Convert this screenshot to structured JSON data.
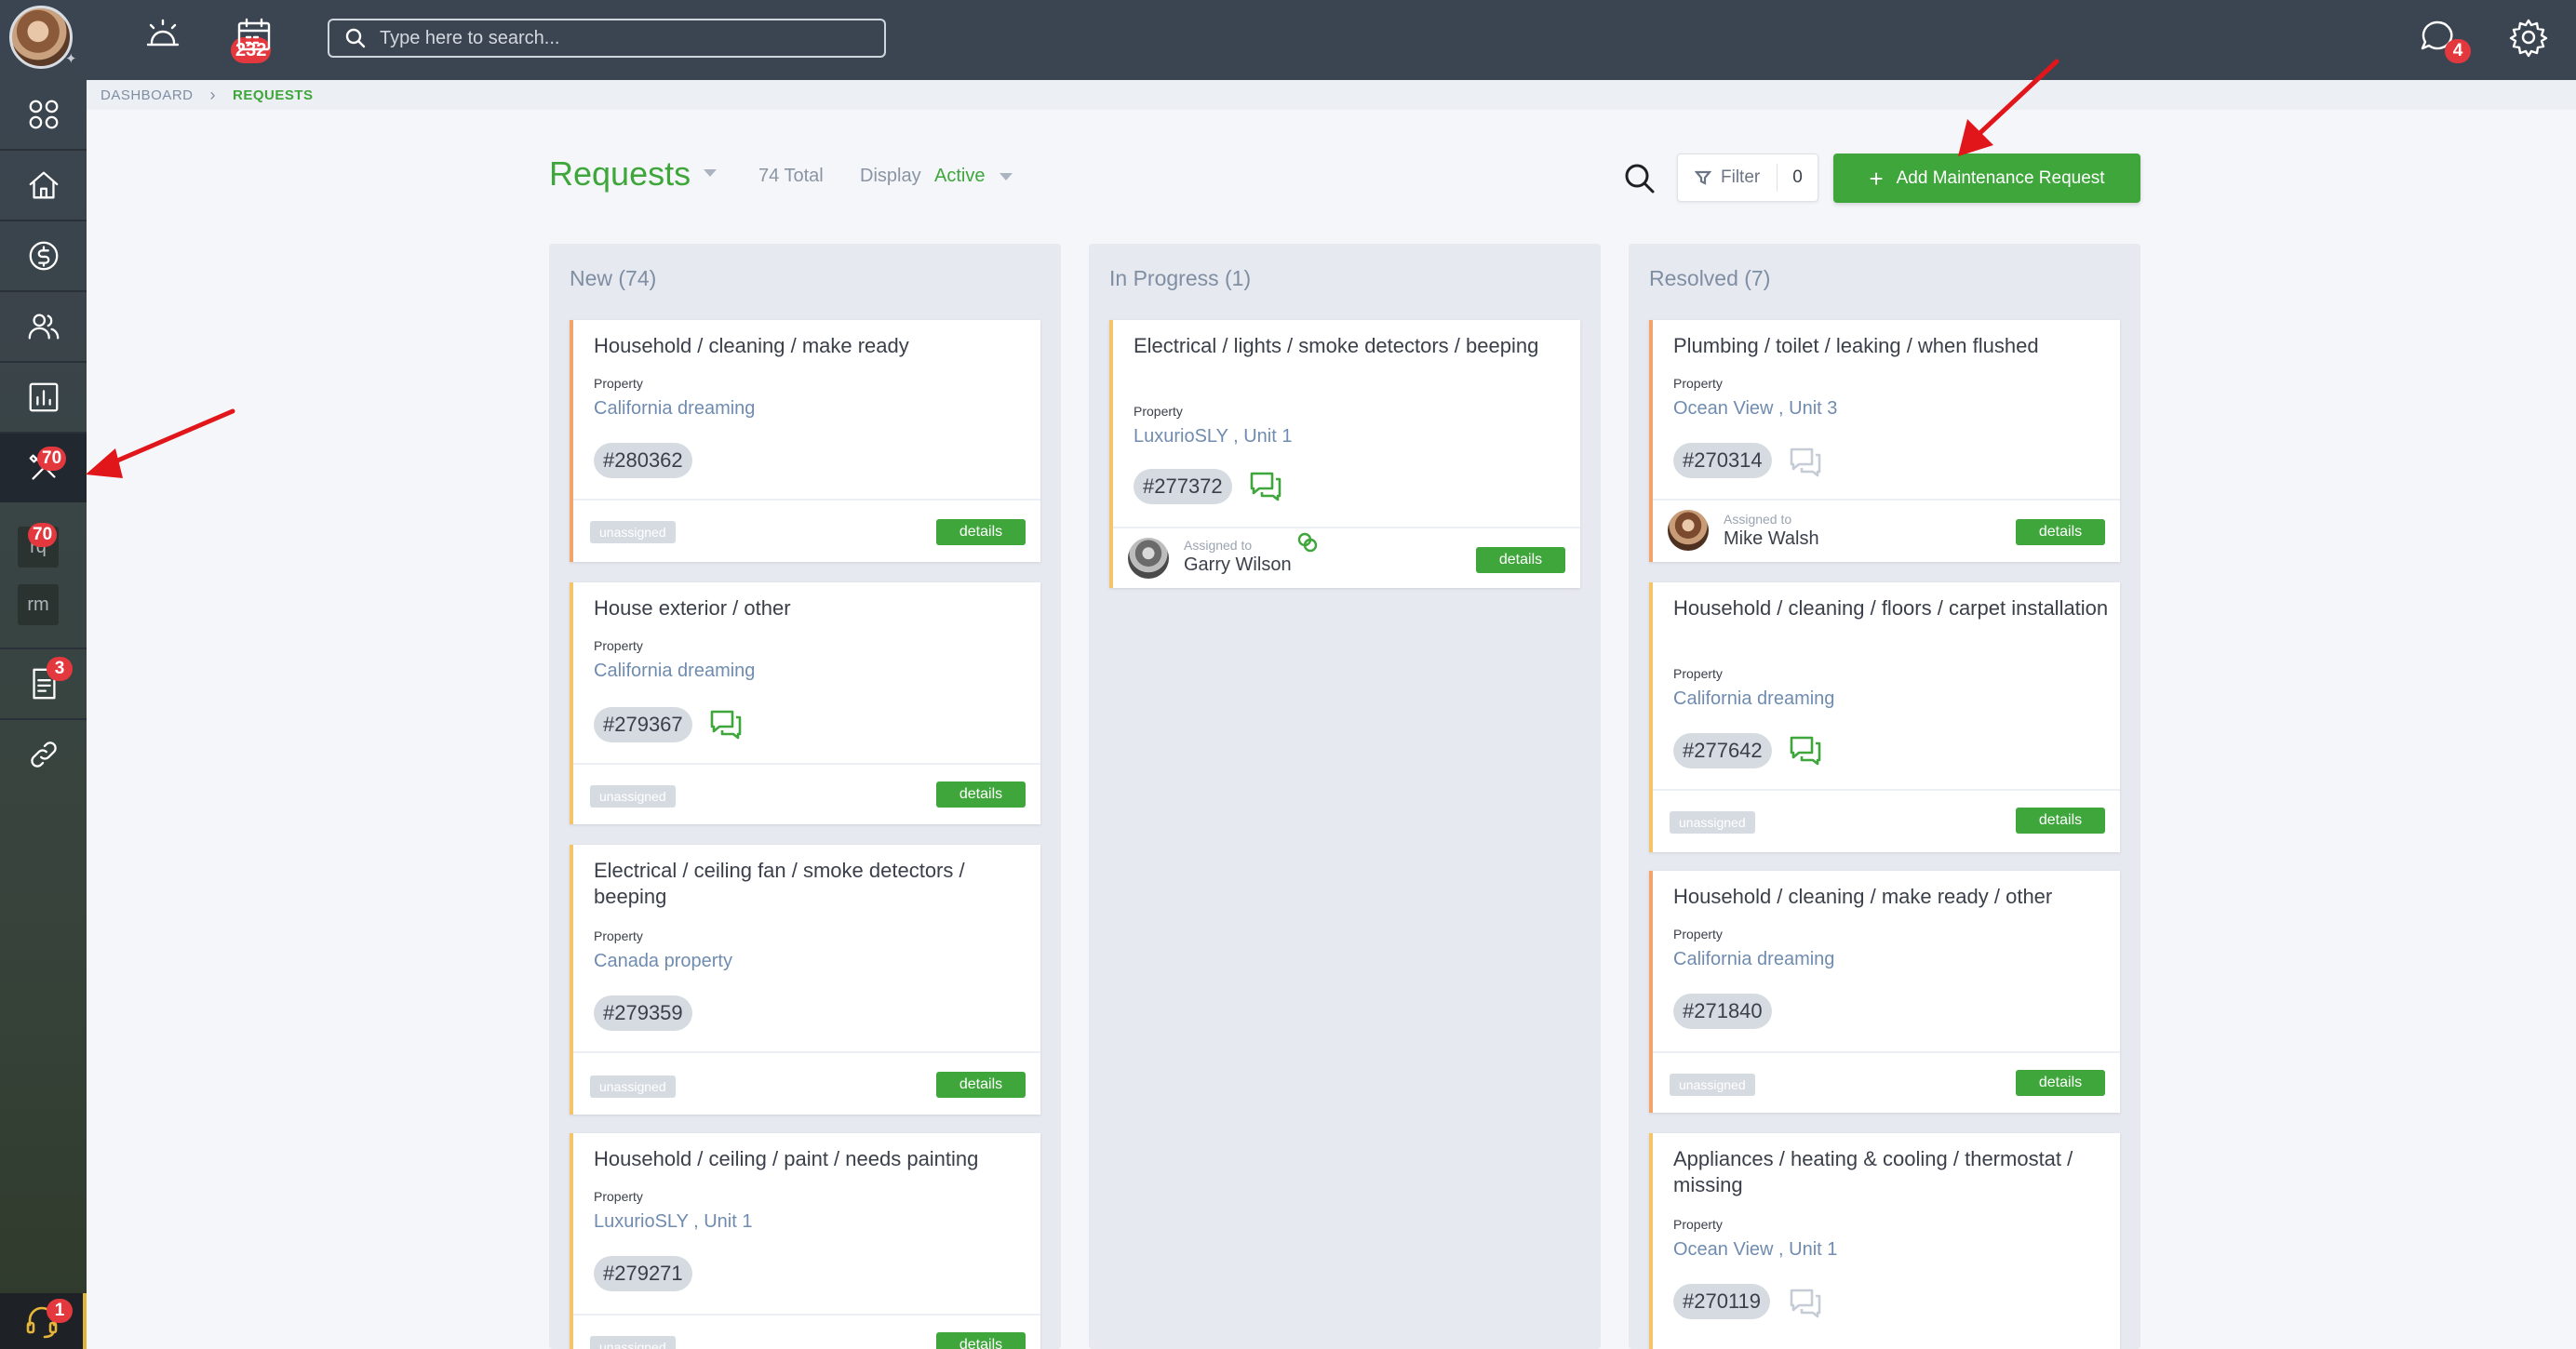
{
  "topbar": {
    "alerts_badge": "232",
    "search_placeholder": "Type here to search...",
    "messages_badge": "4"
  },
  "sidebar": {
    "maintenance_badge": "70",
    "tile_rq_label": "rq",
    "tile_rq_badge": "70",
    "tile_rm_label": "rm",
    "documents_badge": "3",
    "support_badge": "1"
  },
  "breadcrumb": {
    "dashboard": "DASHBOARD",
    "separator": "›",
    "current": "REQUESTS"
  },
  "header": {
    "title": "Requests",
    "total": "74 Total",
    "display_label": "Display",
    "display_value": "Active",
    "filter_label": "Filter",
    "filter_count": "0",
    "add_label": "Add Maintenance Request"
  },
  "common": {
    "property_label": "Property",
    "details_label": "details",
    "unassigned_label": "unassigned",
    "assigned_to_label": "Assigned to"
  },
  "columns": {
    "new": {
      "title": "New (74)",
      "cards": [
        {
          "title": "Household / cleaning / make ready",
          "property": "California dreaming",
          "id": "#280362"
        },
        {
          "title": "House exterior / other",
          "property": "California dreaming",
          "id": "#279367"
        },
        {
          "title": "Electrical / ceiling fan / smoke detectors / beeping",
          "property": "Canada property",
          "id": "#279359"
        },
        {
          "title": "Household / ceiling / paint / needs painting",
          "property": "LuxurioSLY , Unit 1",
          "id": "#279271"
        }
      ]
    },
    "progress": {
      "title": "In Progress (1)",
      "cards": [
        {
          "title": "Electrical / lights / smoke detectors / beeping",
          "property": "LuxurioSLY , Unit 1",
          "id": "#277372",
          "assignee": "Garry Wilson"
        }
      ]
    },
    "resolved": {
      "title": "Resolved (7)",
      "cards": [
        {
          "title": "Plumbing / toilet / leaking / when flushed",
          "property": "Ocean View , Unit 3",
          "id": "#270314",
          "assignee": "Mike Walsh"
        },
        {
          "title": "Household / cleaning / floors / carpet installation",
          "property": "California dreaming",
          "id": "#277642"
        },
        {
          "title": "Household / cleaning / make ready / other",
          "property": "California dreaming",
          "id": "#271840"
        },
        {
          "title": "Appliances / heating & cooling / thermostat / missing",
          "property": "Ocean View , Unit 1",
          "id": "#270119"
        }
      ]
    }
  },
  "colors": {
    "accent_green": "#3ea63a",
    "badge_red": "#e4383f",
    "sidebar_bg": "#3b4552",
    "annotation_red": "#e0161b"
  }
}
